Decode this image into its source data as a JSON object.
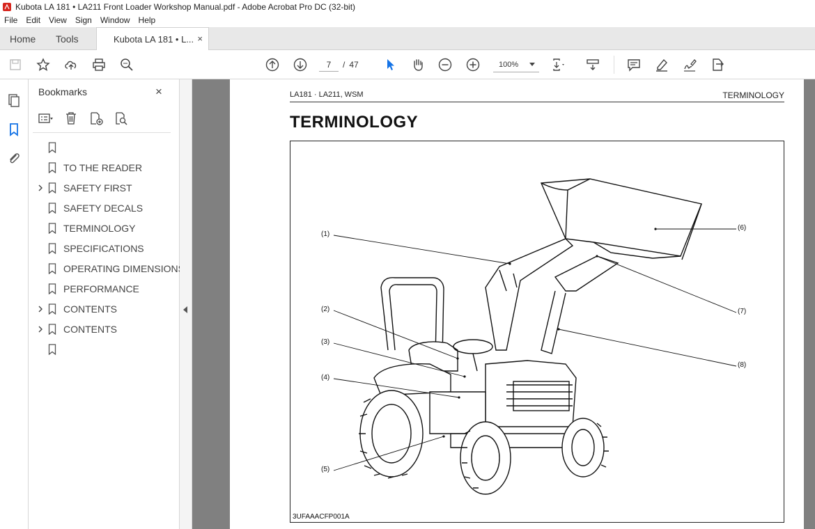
{
  "window": {
    "title": "Kubota LA 181 • LA211 Front Loader Workshop Manual.pdf - Adobe Acrobat Pro DC (32-bit)"
  },
  "menu": [
    "File",
    "Edit",
    "View",
    "Sign",
    "Window",
    "Help"
  ],
  "tabs": {
    "home": "Home",
    "tools": "Tools",
    "document": "Kubota LA 181 • L...",
    "close": "×"
  },
  "toolbar": {
    "current_page": "7",
    "page_separator": "/",
    "total_pages": "47",
    "zoom": "100%"
  },
  "bookmarks_panel": {
    "title": "Bookmarks",
    "close": "×",
    "items": [
      {
        "label": "",
        "expandable": false
      },
      {
        "label": "TO THE READER",
        "expandable": false
      },
      {
        "label": "SAFETY FIRST",
        "expandable": true
      },
      {
        "label": "SAFETY DECALS",
        "expandable": false
      },
      {
        "label": "TERMINOLOGY",
        "expandable": false
      },
      {
        "label": "SPECIFICATIONS",
        "expandable": false
      },
      {
        "label": "OPERATING DIMENSIONS",
        "expandable": false
      },
      {
        "label": "PERFORMANCE",
        "expandable": false
      },
      {
        "label": "CONTENTS",
        "expandable": true
      },
      {
        "label": "CONTENTS",
        "expandable": true
      },
      {
        "label": "",
        "expandable": false
      }
    ]
  },
  "page": {
    "header_left": "LA181 · LA211, WSM",
    "header_right": "TERMINOLOGY",
    "title": "TERMINOLOGY",
    "figure_code": "3UFAAACFP001A",
    "callouts": [
      "(1)",
      "(2)",
      "(3)",
      "(4)",
      "(5)",
      "(6)",
      "(7)",
      "(8)"
    ]
  },
  "colors": {
    "accent_blue": "#1473e6",
    "viewer_bg": "#808080",
    "acrobat_red": "#d7261e"
  }
}
